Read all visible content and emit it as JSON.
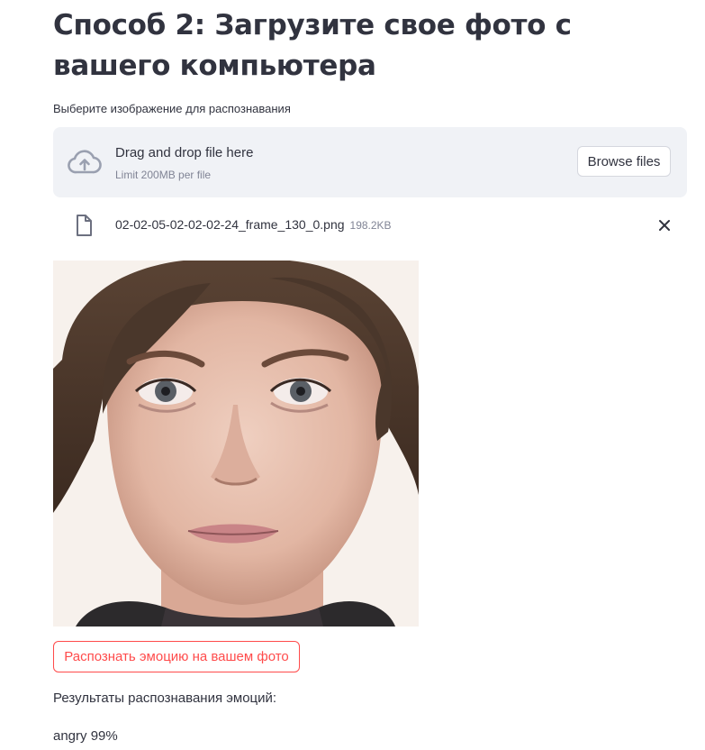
{
  "page": {
    "title": "Способ 2: Загрузите свое фото с вашего компьютера"
  },
  "uploader": {
    "label": "Выберите изображение для распознавания",
    "dropzone_title": "Drag and drop file here",
    "dropzone_limit": "Limit 200MB per file",
    "browse_label": "Browse files",
    "icon": "cloud-upload-icon"
  },
  "uploaded_file": {
    "name": "02-02-05-02-02-02-24_frame_130_0.png",
    "size": "198.2KB",
    "icon": "file-icon",
    "remove_icon": "close-icon"
  },
  "image": {
    "alt": "uploaded face photo"
  },
  "action": {
    "label": "Распознать эмоцию на вашем фото"
  },
  "results": {
    "label": "Результаты распознавания эмоций:",
    "value": "angry 99%"
  },
  "colors": {
    "accent": "#ff4b4b",
    "text": "#31333f",
    "muted": "#808495",
    "dropzone_bg": "#f0f2f6"
  }
}
